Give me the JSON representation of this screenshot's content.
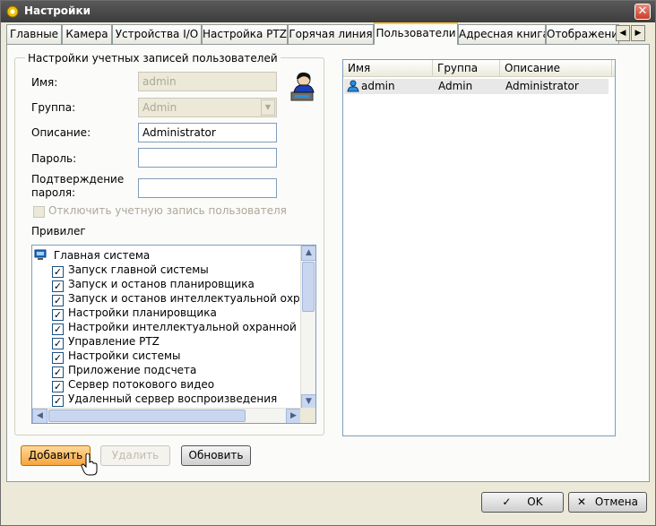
{
  "window": {
    "title": "Настройки",
    "close_glyph": "✕"
  },
  "tabs": [
    {
      "label": "Главные"
    },
    {
      "label": "Камера"
    },
    {
      "label": "Устройства I/O"
    },
    {
      "label": "Настройка PTZ"
    },
    {
      "label": "Горячая линия"
    },
    {
      "label": "Пользователи",
      "active": true
    },
    {
      "label": "Адресная книга"
    },
    {
      "label": "Отображени"
    }
  ],
  "tab_scroll": {
    "left": "◀",
    "right": "▶"
  },
  "account": {
    "group_title": "Настройки учетных записей пользователей",
    "name_label": "Имя:",
    "name_value": "admin",
    "group_label": "Группа:",
    "group_value": "Admin",
    "description_label": "Описание:",
    "description_value": "Administrator",
    "password_label": "Пароль:",
    "password_value": "",
    "confirm_label_1": "Подтверждение",
    "confirm_label_2": "пароля:",
    "confirm_value": "",
    "disable_label": "Отключить учетную запись пользователя",
    "privileges_label": "Привилег"
  },
  "privileges": {
    "root": "Главная система",
    "items": [
      {
        "label": "Запуск главной системы",
        "checked": true
      },
      {
        "label": "Запуск и останов планировщика",
        "checked": true
      },
      {
        "label": "Запуск  и останов интеллектуальной охранной",
        "checked": true
      },
      {
        "label": "Настройки планировщика",
        "checked": true
      },
      {
        "label": "Настройки интеллектуальной охранной системы",
        "checked": true
      },
      {
        "label": "Управление PTZ",
        "checked": true
      },
      {
        "label": "Настройки системы",
        "checked": true
      },
      {
        "label": "Приложение подсчета",
        "checked": true
      },
      {
        "label": "Сервер потокового видео",
        "checked": true
      },
      {
        "label": "Удаленный сервер воспроизведения",
        "checked": true
      }
    ]
  },
  "users_table": {
    "columns": [
      "Имя",
      "Группа",
      "Описание"
    ],
    "rows": [
      {
        "name": "admin",
        "group": "Admin",
        "description": "Administrator"
      }
    ]
  },
  "actions": {
    "add": "Добавить",
    "delete": "Удалить",
    "refresh": "Обновить"
  },
  "footer": {
    "ok": "OK",
    "cancel": "Отмена"
  },
  "colors": {
    "active_tab_accent": "#ffc83c",
    "add_button": "#f7a53a",
    "title_bar": "#4a4a4a"
  }
}
